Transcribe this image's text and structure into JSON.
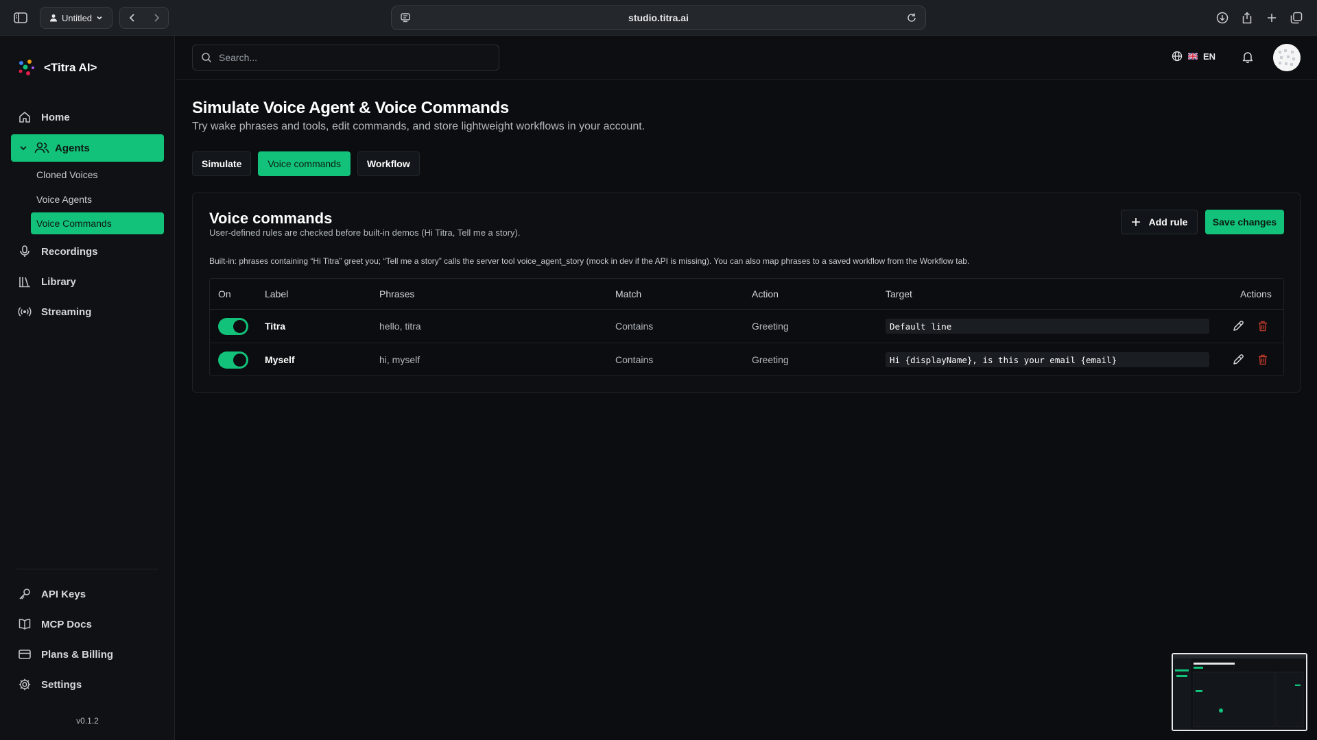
{
  "browser": {
    "profile_label": "Untitled",
    "url": "studio.titra.ai"
  },
  "brand": {
    "name": "<Titra AI>"
  },
  "sidebar": {
    "items": [
      {
        "label": "Home",
        "icon": "home-icon"
      },
      {
        "label": "Agents",
        "icon": "users-icon",
        "active": true
      },
      {
        "label": "Recordings",
        "icon": "microphone-icon"
      },
      {
        "label": "Library",
        "icon": "library-icon"
      },
      {
        "label": "Streaming",
        "icon": "broadcast-icon"
      }
    ],
    "agents_sub": [
      {
        "label": "Cloned Voices"
      },
      {
        "label": "Voice Agents"
      },
      {
        "label": "Voice Commands",
        "active": true
      }
    ],
    "bottom_items": [
      {
        "label": "API Keys",
        "icon": "key-icon"
      },
      {
        "label": "MCP Docs",
        "icon": "book-icon"
      },
      {
        "label": "Plans & Billing",
        "icon": "credit-card-icon"
      },
      {
        "label": "Settings",
        "icon": "gear-icon"
      }
    ],
    "version": "v0.1.2"
  },
  "topbar": {
    "search_placeholder": "Search...",
    "language": "EN"
  },
  "page": {
    "title": "Simulate Voice Agent & Voice Commands",
    "subtitle": "Try wake phrases and tools, edit commands, and store lightweight workflows in your account.",
    "tabs": [
      {
        "label": "Simulate"
      },
      {
        "label": "Voice commands",
        "active": true
      },
      {
        "label": "Workflow"
      }
    ]
  },
  "voice_commands": {
    "title": "Voice commands",
    "subtitle": "User-defined rules are checked before built-in demos (Hi Titra, Tell me a story).",
    "add_rule_label": "Add rule",
    "save_label": "Save changes",
    "note": "Built-in: phrases containing “Hi Titra” greet you; “Tell me a story” calls the server tool voice_agent_story (mock in dev if the API is missing). You can also map phrases to a saved workflow from the Workflow tab.",
    "columns": [
      "On",
      "Label",
      "Phrases",
      "Match",
      "Action",
      "Target",
      "Actions"
    ],
    "rows": [
      {
        "on": true,
        "label": "Titra",
        "phrases": "hello, titra",
        "match": "Contains",
        "action": "Greeting",
        "target": "Default line"
      },
      {
        "on": true,
        "label": "Myself",
        "phrases": "hi, myself",
        "match": "Contains",
        "action": "Greeting",
        "target": "Hi {displayName}, is this your email {email}"
      }
    ]
  },
  "colors": {
    "accent": "#12c27a",
    "background": "#0b0d10",
    "danger": "#c0392b"
  }
}
